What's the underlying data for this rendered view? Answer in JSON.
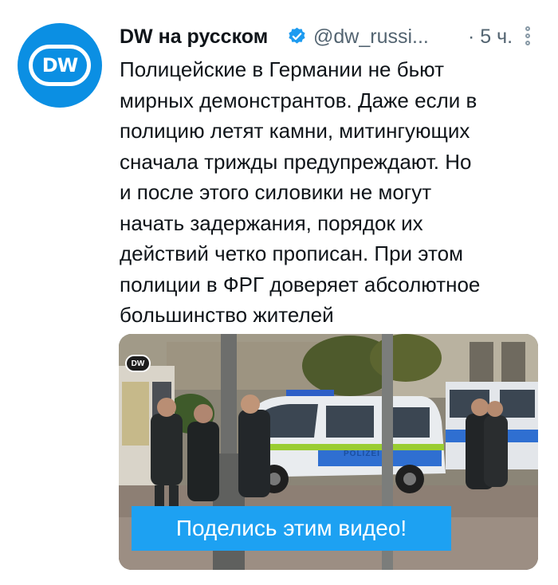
{
  "author": {
    "name": "DW на русском",
    "handle": "@dw_russi...",
    "time": "· 5 ч.",
    "avatar_text": "DW"
  },
  "tweet": {
    "text": "Полицейские в Германии не бьют\nмирных демонстрантов. Даже если в\nполицию летят камни, митингующих\nсначала трижды предупреждают. Но\nи после этого силовики не могут\nначать задержания, порядок их\nдействий четко прописан. При этом\nполиции в ФРГ доверяет абсолютное\nбольшинство жителей"
  },
  "media": {
    "logo_text": "DW",
    "vehicle_text": "POLIZEI",
    "cta_label": "Поделись этим видео!"
  },
  "colors": {
    "accent": "#1da1f2",
    "avatar_bg": "#0b8fe3",
    "muted": "#536471"
  },
  "icons": [
    "verified-badge-icon",
    "more-options-icon"
  ]
}
